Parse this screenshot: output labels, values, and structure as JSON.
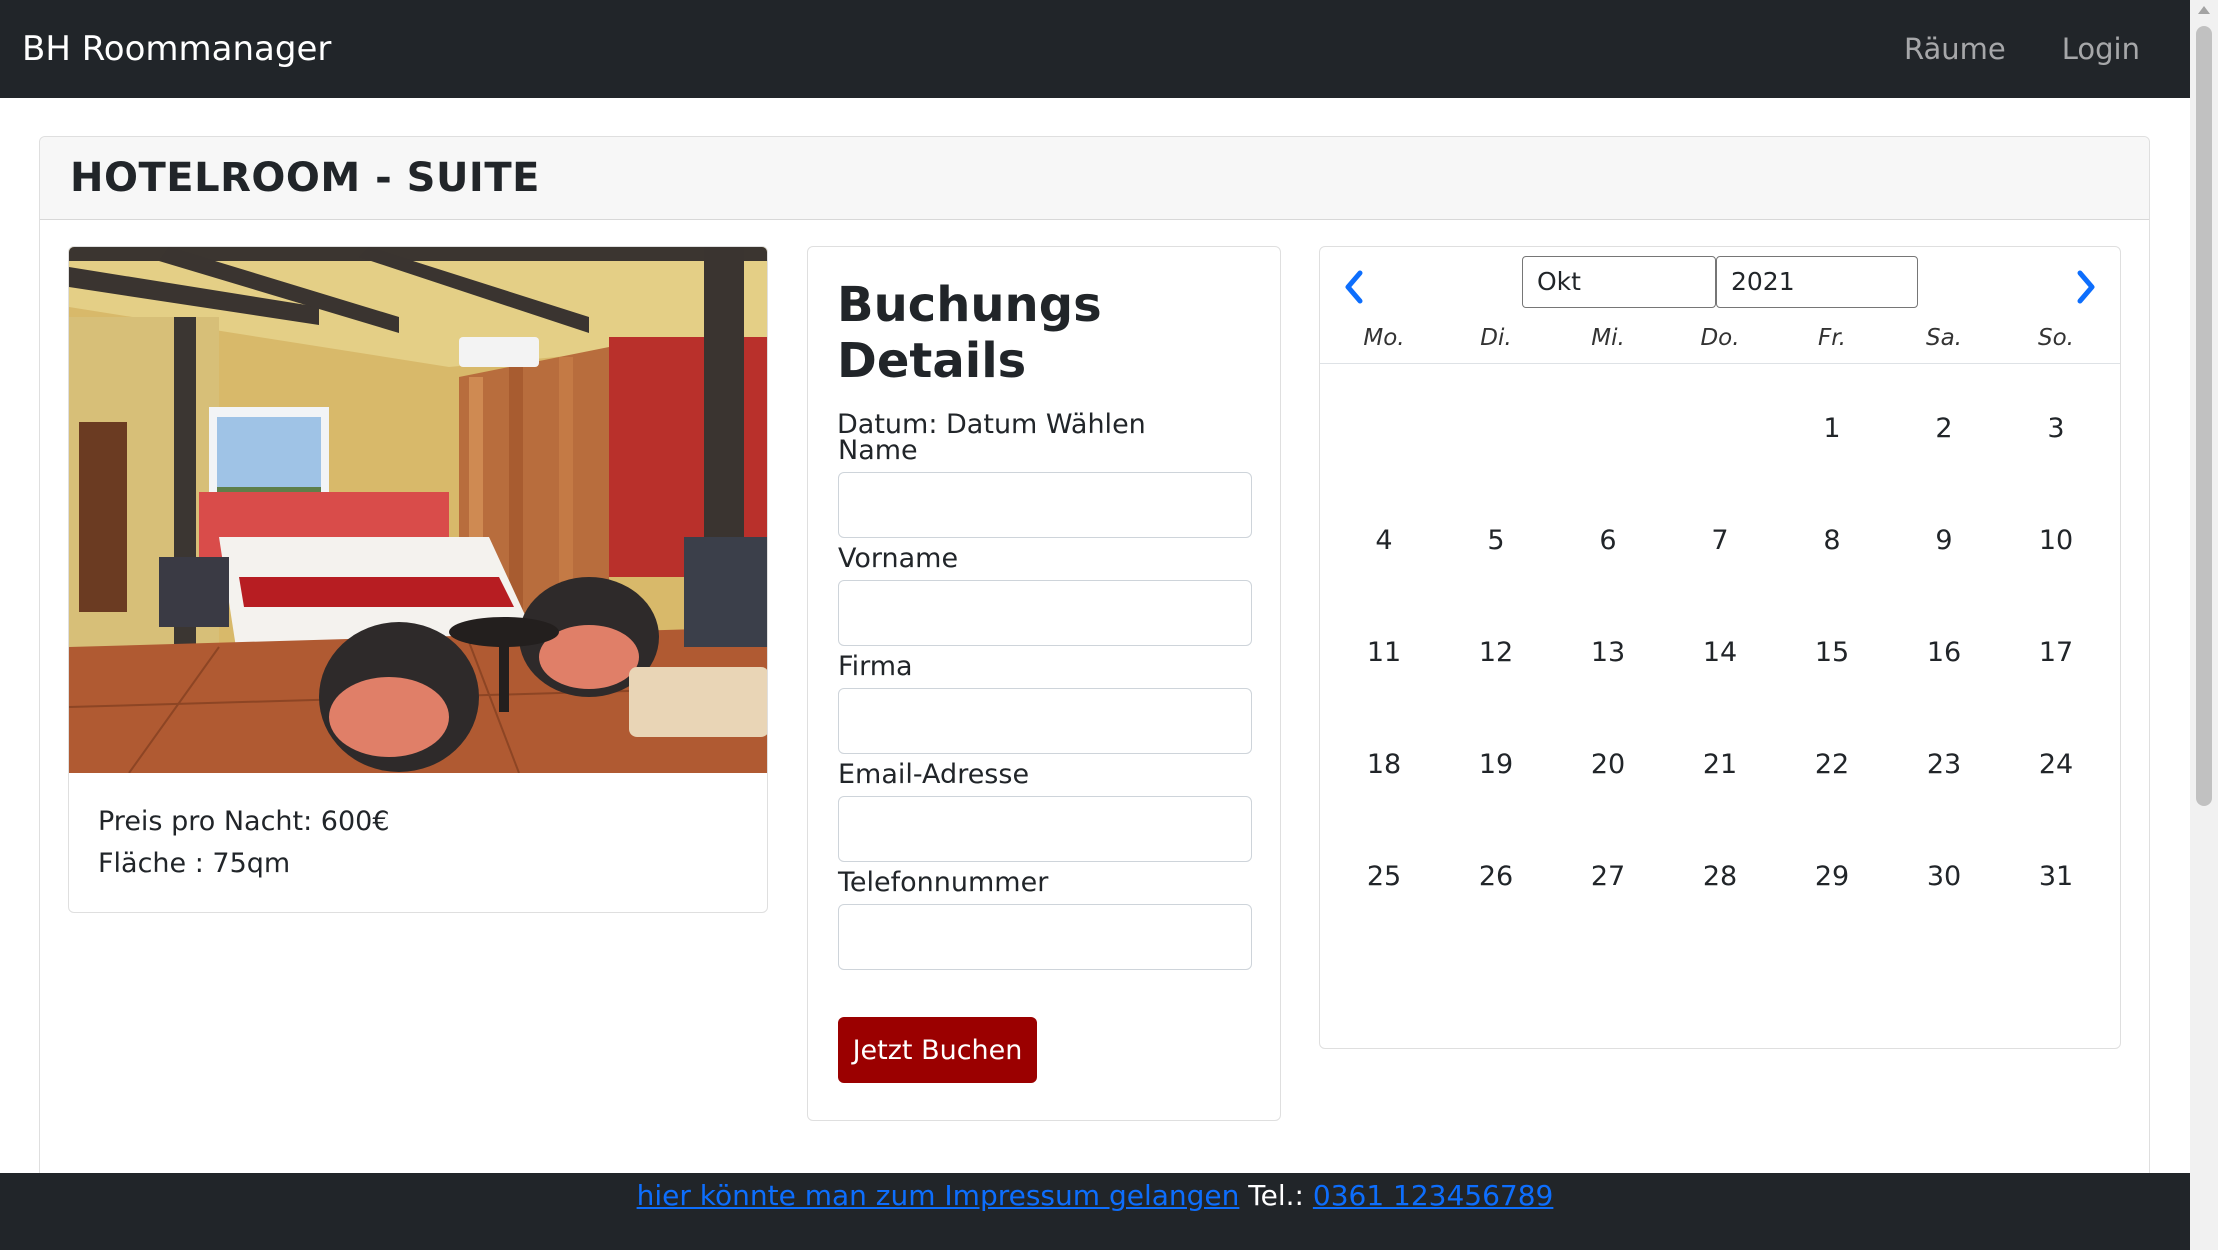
{
  "navbar": {
    "brand": "BH Roommanager",
    "links": [
      "Räume",
      "Login"
    ]
  },
  "page": {
    "title": "HOTELROOM - SUITE"
  },
  "room": {
    "price": "Preis pro Nacht: 600€",
    "area": "Fläche : 75qm"
  },
  "booking": {
    "title": "Buchungs Details",
    "date_text": "Datum: Datum Wählen",
    "fields": [
      {
        "label": "Name",
        "value": ""
      },
      {
        "label": "Vorname",
        "value": ""
      },
      {
        "label": "Firma",
        "value": ""
      },
      {
        "label": "Email-Adresse",
        "value": ""
      },
      {
        "label": "Telefonnummer",
        "value": ""
      }
    ],
    "button_label": "Jetzt Buchen",
    "button_color": "#9b0000"
  },
  "calendar": {
    "month": "Okt",
    "year": "2021",
    "weekdays": [
      "Mo.",
      "Di.",
      "Mi.",
      "Do.",
      "Fr.",
      "Sa.",
      "So."
    ],
    "days": [
      "1",
      "2",
      "3",
      "4",
      "5",
      "6",
      "7",
      "8",
      "9",
      "10",
      "11",
      "12",
      "13",
      "14",
      "15",
      "16",
      "17",
      "18",
      "19",
      "20",
      "21",
      "22",
      "23",
      "24",
      "25",
      "26",
      "27",
      "28",
      "29",
      "30",
      "31"
    ],
    "arrow_color": "#0d6efd"
  },
  "footer": {
    "impressum_link": "hier könnte man zum Impressum gelangen",
    "tel_label": "Tel.:",
    "phone": "0361 123456789"
  }
}
